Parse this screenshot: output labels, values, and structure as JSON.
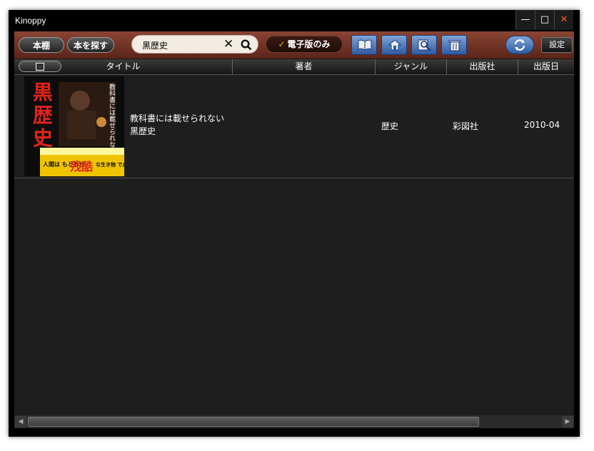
{
  "window": {
    "title": "Kinoppy"
  },
  "toolbar": {
    "shelf_label": "本棚",
    "find_label": "本を探す",
    "search_value": "黒歴史",
    "search_placeholder": "",
    "ebook_only_label": "電子版のみ",
    "settings_label": "設定"
  },
  "table": {
    "columns": {
      "title": "タイトル",
      "author": "著者",
      "genre": "ジャンル",
      "publisher": "出版社",
      "date": "出版日"
    },
    "rows": [
      {
        "title_line1": "教科書には載せられない",
        "title_line2": "黒歴史",
        "author": "",
        "genre": "歴史",
        "publisher": "彩図社",
        "date": "2010-04",
        "cover": {
          "main_text": "黒歴史",
          "subtitle": "教科書には載せられない",
          "bottom_left": "人間は もともと",
          "bottom_emphasis": "残酷",
          "bottom_right": "な生き物 である"
        }
      }
    ]
  },
  "colors": {
    "toolbar": "#7a3a2c",
    "content_bg": "#1e1e1e",
    "accent_blue": "#3d6ab3",
    "close": "#ff5a1f"
  }
}
